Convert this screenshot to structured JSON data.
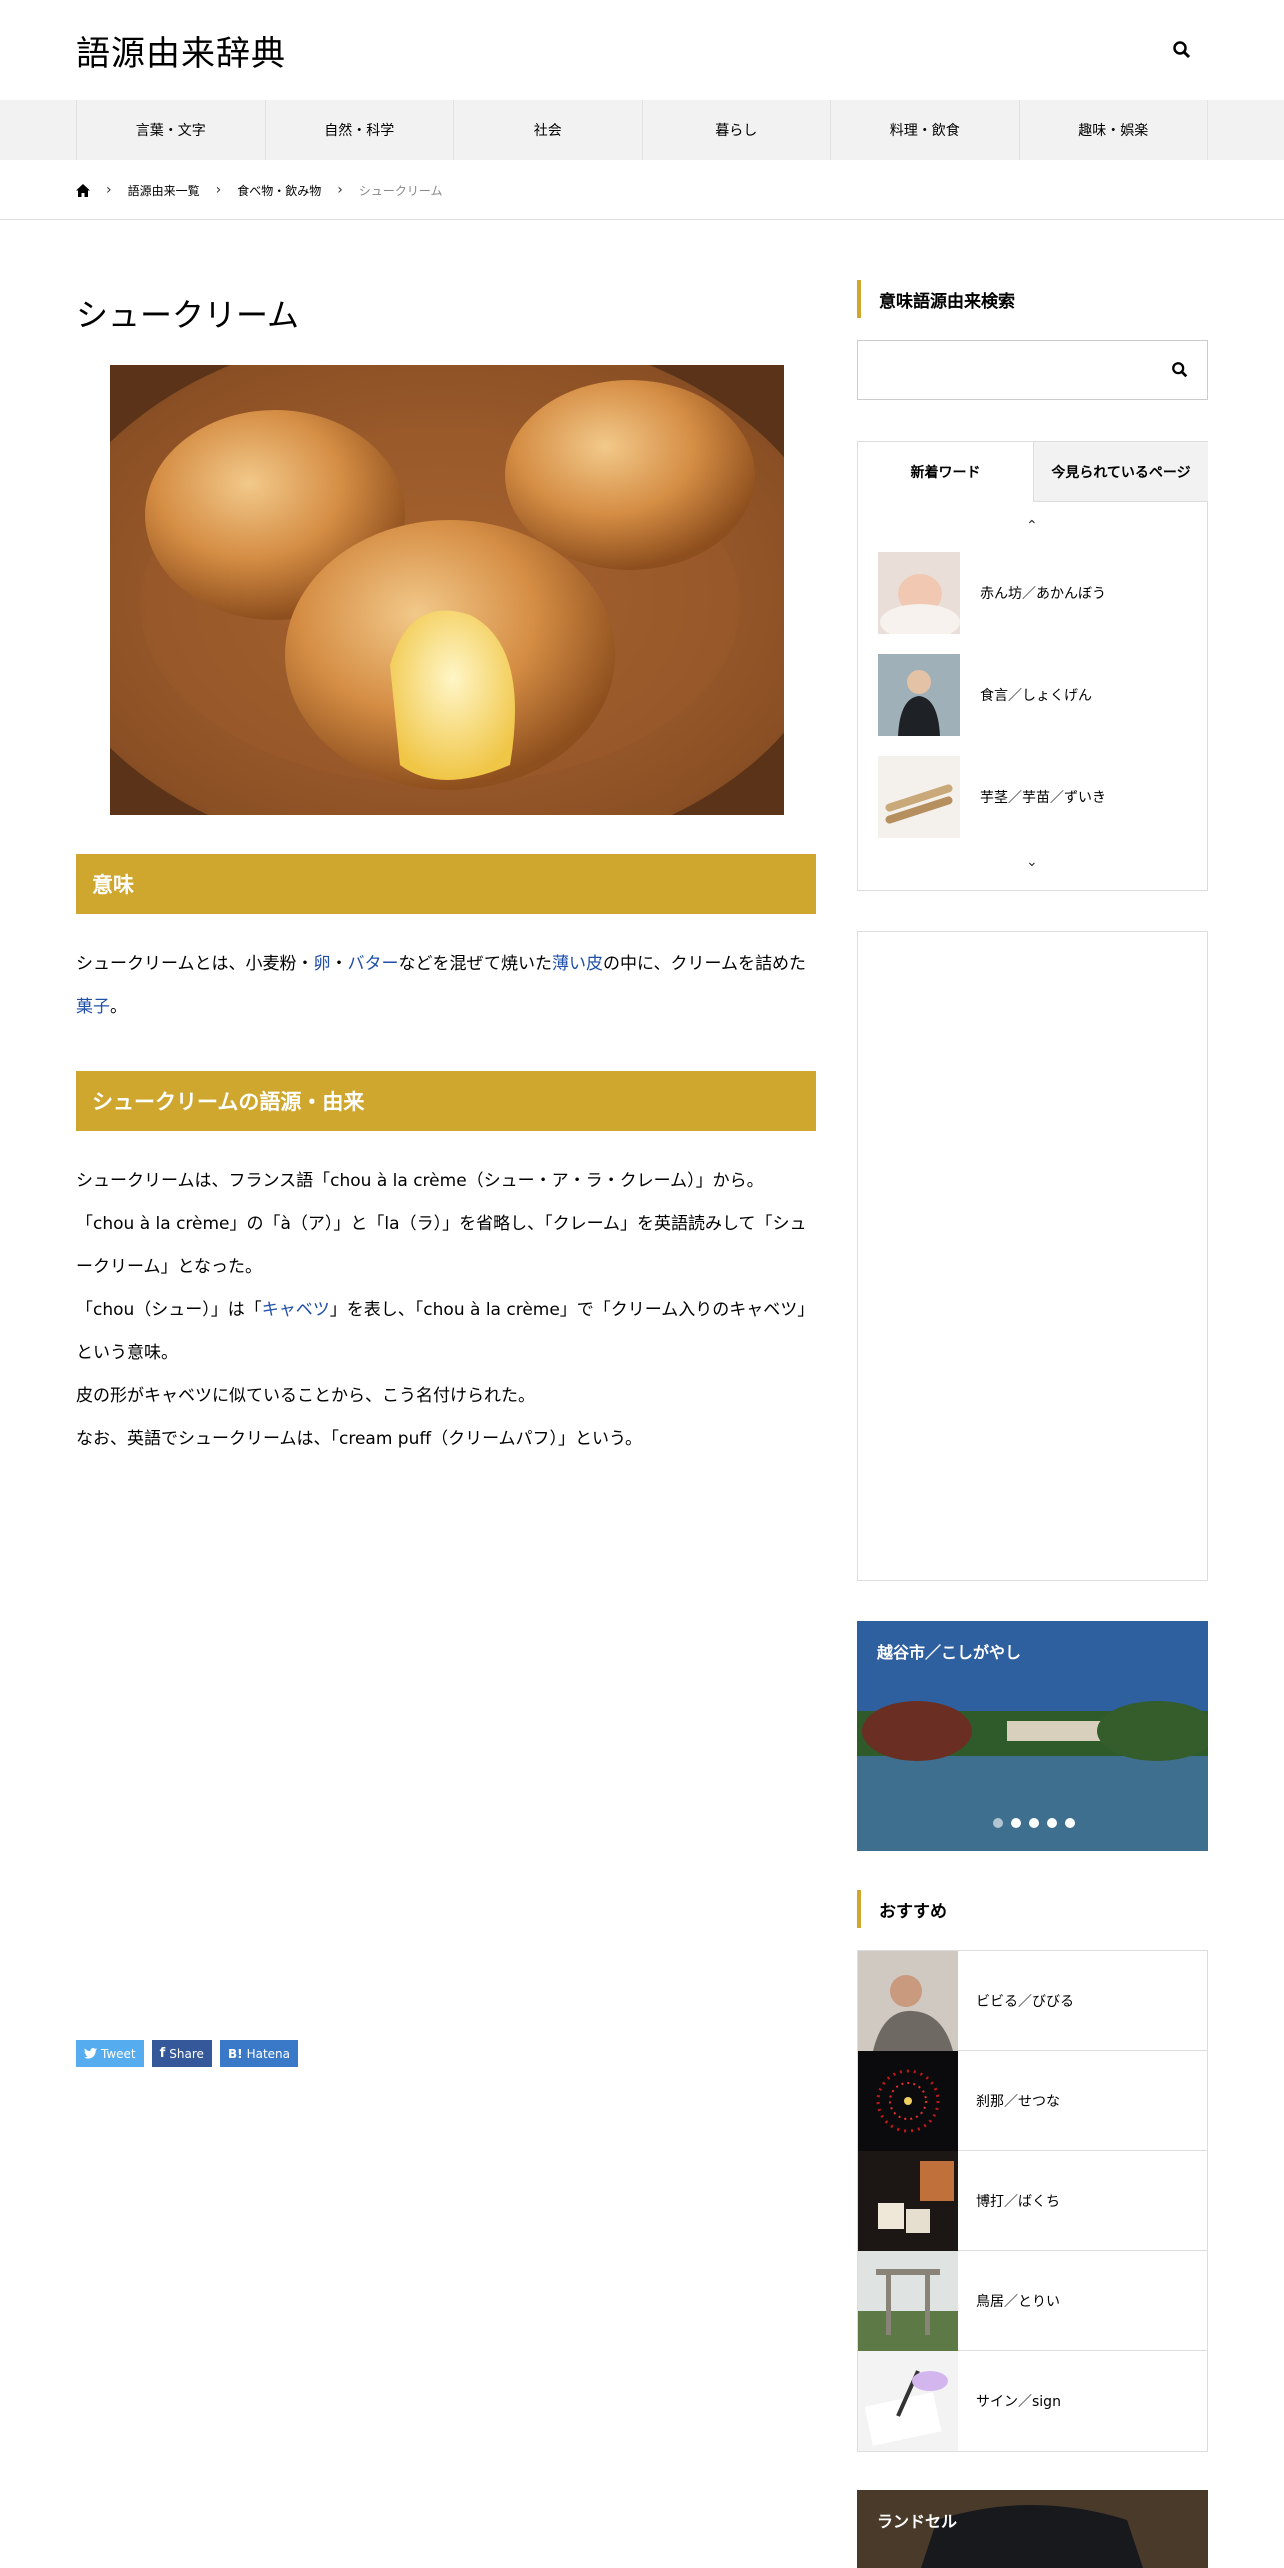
{
  "site": {
    "logo": "語源由来辞典"
  },
  "nav": [
    "言葉・文字",
    "自然・科学",
    "社会",
    "暮らし",
    "料理・飲食",
    "趣味・娯楽"
  ],
  "breadcrumb": {
    "items": [
      "語源由来一覧",
      "食べ物・飲み物"
    ],
    "current": "シュークリーム"
  },
  "article": {
    "title": "シュークリーム",
    "section1": "意味",
    "meaning": {
      "p1": "シュークリームとは、小麦粉・",
      "egg": "卵",
      "p2": "・",
      "butter": "バター",
      "p3": "などを混ぜて焼いた",
      "skin": "薄い皮",
      "p4": "の中に、クリームを詰めた",
      "confection": "菓子",
      "p5": "。"
    },
    "section2": "シュークリームの語源・由来",
    "origin": {
      "l1": "シュークリームは、フランス語「chou à la crème（シュー・ア・ラ・クレーム）」から。",
      "l2": "「chou à la crème」の「à（ア）」と「la（ラ）」を省略し、「クレーム」を英語読みして「シュークリーム」となった。",
      "l3a": "「chou（シュー）」は「",
      "cabbage": "キャベツ",
      "l3b": "」を表し、「chou à la crème」で「クリーム入りのキャベツ」という意味。",
      "l4": "皮の形がキャベツに似ていることから、こう名付けられた。",
      "l5": "なお、英語でシュークリームは、「cream puff（クリームパフ）」という。"
    },
    "share": {
      "tweet": "Tweet",
      "share": "Share",
      "hatena": "Hatena"
    }
  },
  "sidebar": {
    "search_title": "意味語源由来検索",
    "tabs": {
      "tab1": "新着ワード",
      "tab2": "今見られているページ"
    },
    "new_words": [
      "赤ん坊／あかんぼう",
      "食言／しょくげん",
      "芋茎／芋苗／ずいき"
    ],
    "slider_title": "越谷市／こしがやし",
    "recommend_title": "おすすめ",
    "recommend": [
      "ビビる／びびる",
      "刹那／せつな",
      "博打／ばくち",
      "鳥居／とりい",
      "サイン／sign"
    ],
    "last_card": "ランドセル"
  }
}
